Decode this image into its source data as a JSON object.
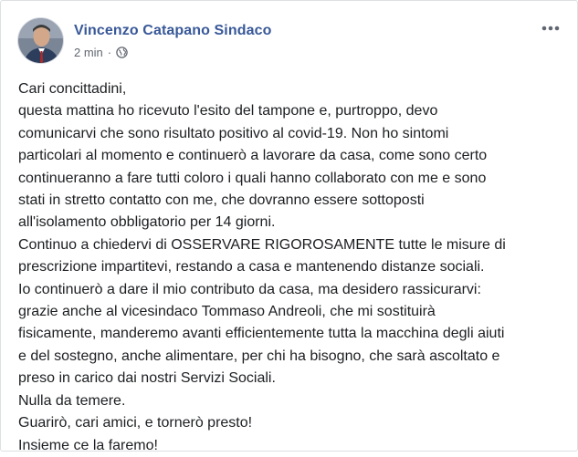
{
  "post": {
    "author": "Vincenzo Catapano Sindaco",
    "time": "2 min",
    "separator": "·",
    "privacy_icon": "globe-icon",
    "menu_icon": "more-options-icon",
    "lines": [
      "Cari concittadini,",
      "questa mattina ho ricevuto l'esito del tampone e, purtroppo, devo",
      "comunicarvi che sono risultato positivo al covid-19. Non ho sintomi",
      "particolari al momento e continuerò a lavorare da casa, come sono certo",
      "continueranno a fare tutti coloro i quali hanno collaborato con me e sono",
      "stati in stretto contatto con me, che dovranno essere sottoposti",
      "all'isolamento obbligatorio per 14 giorni.",
      "Continuo a chiedervi di OSSERVARE RIGOROSAMENTE tutte le misure di",
      "prescrizione impartitevi, restando a casa e mantenendo distanze sociali.",
      "Io continuerò a dare il mio contributo da casa, ma desidero rassicurarvi:",
      "grazie anche al vicesindaco Tommaso Andreoli, che mi sostituirà",
      "fisicamente, manderemo avanti efficientemente tutta la macchina degli aiuti",
      "e del sostegno, anche alimentare, per chi ha bisogno, che sarà ascoltato e",
      "preso in carico dai nostri Servizi Sociali.",
      "Nulla da temere.",
      "Guarirò, cari amici, e tornerò presto!",
      "Insieme ce la faremo!"
    ]
  },
  "colors": {
    "author": "#385898",
    "meta": "#616770",
    "text": "#1c1e21"
  }
}
